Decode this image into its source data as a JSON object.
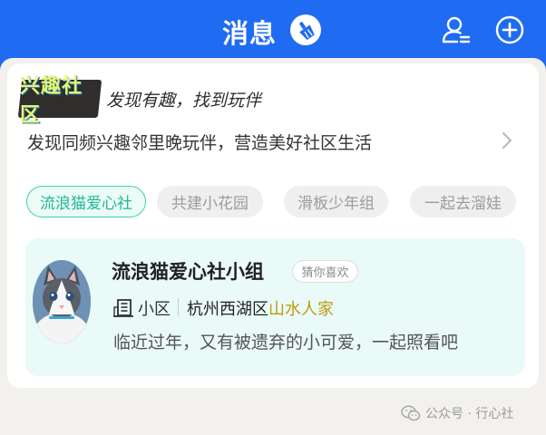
{
  "header": {
    "title": "消息",
    "icons": [
      "broom-clean-icon",
      "user-list-icon",
      "add-circle-icon"
    ],
    "accent_color": "#1f6cf2"
  },
  "promo": {
    "logo_text": "兴趣社区",
    "slogan": "发现有趣，找到玩伴",
    "description": "发现同频兴趣邻里晚玩伴，营造美好社区生活"
  },
  "tags": [
    {
      "label": "流浪猫爱心社",
      "active": true
    },
    {
      "label": "共建小花园",
      "active": false
    },
    {
      "label": "滑板少年组",
      "active": false
    },
    {
      "label": "一起去溜娃",
      "active": false
    }
  ],
  "group": {
    "name": "流浪猫爱心社小组",
    "badge": "猜你喜欢",
    "type": "小区",
    "location_prefix": "杭州西湖区",
    "location_highlight": "山水人家",
    "description": "临近过年，又有被遗弃的小可爱，一起照看吧"
  },
  "footer": {
    "text": "公众号 · 行心社"
  }
}
